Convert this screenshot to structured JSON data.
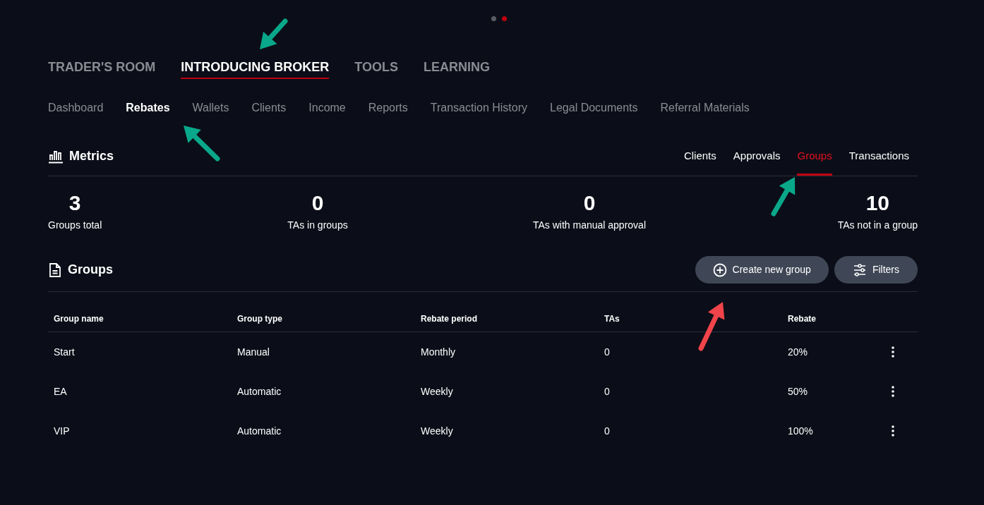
{
  "pager_dots": [
    {
      "selected": false
    },
    {
      "selected": true
    }
  ],
  "main_nav": [
    {
      "label": "TRADER'S ROOM",
      "selected": false
    },
    {
      "label": "INTRODUCING BROKER",
      "selected": true
    },
    {
      "label": "TOOLS",
      "selected": false
    },
    {
      "label": "LEARNING",
      "selected": false
    }
  ],
  "sub_nav": [
    {
      "label": "Dashboard",
      "selected": false
    },
    {
      "label": "Rebates",
      "selected": true
    },
    {
      "label": "Wallets",
      "selected": false
    },
    {
      "label": "Clients",
      "selected": false
    },
    {
      "label": "Income",
      "selected": false
    },
    {
      "label": "Reports",
      "selected": false
    },
    {
      "label": "Transaction History",
      "selected": false
    },
    {
      "label": "Legal Documents",
      "selected": false
    },
    {
      "label": "Referral Materials",
      "selected": false
    }
  ],
  "metrics": {
    "title": "Metrics",
    "tabs": [
      {
        "label": "Clients",
        "selected": false
      },
      {
        "label": "Approvals",
        "selected": false
      },
      {
        "label": "Groups",
        "selected": true
      },
      {
        "label": "Transactions",
        "selected": false
      }
    ],
    "stats": [
      {
        "value": "3",
        "label": "Groups total"
      },
      {
        "value": "0",
        "label": "TAs in groups"
      },
      {
        "value": "0",
        "label": "TAs with manual approval"
      },
      {
        "value": "10",
        "label": "TAs not in a group"
      }
    ]
  },
  "groups": {
    "title": "Groups",
    "create_button": "Create new group",
    "filters_button": "Filters",
    "columns": [
      "Group name",
      "Group type",
      "Rebate period",
      "TAs",
      "Rebate"
    ],
    "rows": [
      [
        "Start",
        "Manual",
        "Monthly",
        "0",
        "20%"
      ],
      [
        "EA",
        "Automatic",
        "Weekly",
        "0",
        "50%"
      ],
      [
        "VIP",
        "Automatic",
        "Weekly",
        "0",
        "100%"
      ]
    ]
  },
  "annotations": [
    {
      "color": "#0aa88a"
    },
    {
      "color": "#0aa88a"
    },
    {
      "color": "#0aa88a"
    },
    {
      "color": "#f0444a"
    }
  ]
}
